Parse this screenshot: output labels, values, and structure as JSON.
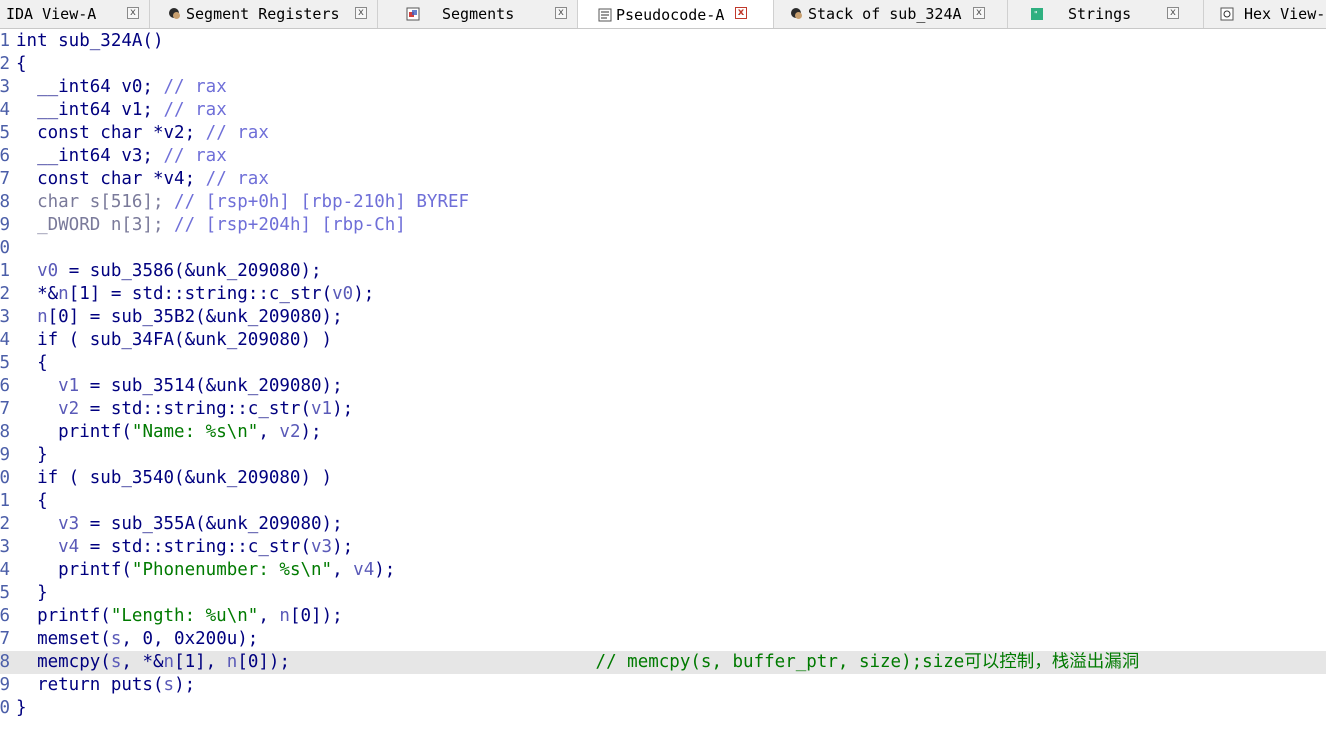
{
  "tabs": [
    {
      "label": "IDA View-A",
      "icon": "ida-view-icon",
      "active": false
    },
    {
      "label": "Segment Registers",
      "icon": "segment-registers-icon",
      "active": false
    },
    {
      "label": "Segments",
      "icon": "segments-icon",
      "active": false
    },
    {
      "label": "Pseudocode-A",
      "icon": "pseudocode-icon",
      "active": true
    },
    {
      "label": "Stack of sub_324A",
      "icon": "stack-icon",
      "active": false
    },
    {
      "label": "Strings",
      "icon": "strings-icon",
      "active": false
    },
    {
      "label": "Hex View-",
      "icon": "hex-view-icon",
      "active": false
    }
  ],
  "close_glyph": "x",
  "colors": {
    "keyword": "#00007f",
    "comment": "#6f6fd8",
    "variable": "#5a5ab8",
    "string": "#007a00",
    "highlight_line": "#e6e6e6",
    "active_close": "#c0392b"
  },
  "code": {
    "highlight_line": 28,
    "lines": [
      {
        "n": "1",
        "segs": [
          {
            "c": "t-plain",
            "t": "int sub_324A()"
          }
        ]
      },
      {
        "n": "2",
        "segs": [
          {
            "c": "t-plain",
            "t": "{"
          }
        ]
      },
      {
        "n": "3",
        "segs": [
          {
            "c": "t-plain",
            "t": "  __int64 v0; "
          },
          {
            "c": "t-comment",
            "t": "// rax"
          }
        ]
      },
      {
        "n": "4",
        "segs": [
          {
            "c": "t-plain",
            "t": "  __int64 v1; "
          },
          {
            "c": "t-comment",
            "t": "// rax"
          }
        ]
      },
      {
        "n": "5",
        "segs": [
          {
            "c": "t-plain",
            "t": "  const char *v2; "
          },
          {
            "c": "t-comment",
            "t": "// rax"
          }
        ]
      },
      {
        "n": "6",
        "segs": [
          {
            "c": "t-plain",
            "t": "  __int64 v3; "
          },
          {
            "c": "t-comment",
            "t": "// rax"
          }
        ]
      },
      {
        "n": "7",
        "segs": [
          {
            "c": "t-plain",
            "t": "  const char *v4; "
          },
          {
            "c": "t-comment",
            "t": "// rax"
          }
        ]
      },
      {
        "n": "8",
        "segs": [
          {
            "c": "t-gray",
            "t": "  char s[516]; "
          },
          {
            "c": "t-comment",
            "t": "// [rsp+0h] [rbp-210h] BYREF"
          }
        ]
      },
      {
        "n": "9",
        "segs": [
          {
            "c": "t-gray",
            "t": "  _DWORD n[3]; "
          },
          {
            "c": "t-comment",
            "t": "// [rsp+204h] [rbp-Ch]"
          }
        ]
      },
      {
        "n": "0",
        "segs": [
          {
            "c": "t-plain",
            "t": ""
          }
        ]
      },
      {
        "n": "1",
        "segs": [
          {
            "c": "t-var",
            "t": "  v0"
          },
          {
            "c": "t-plain",
            "t": " = sub_3586(&unk_209080);"
          }
        ]
      },
      {
        "n": "2",
        "segs": [
          {
            "c": "t-plain",
            "t": "  *&"
          },
          {
            "c": "t-var",
            "t": "n"
          },
          {
            "c": "t-plain",
            "t": "[1] = std::string::c_str("
          },
          {
            "c": "t-var",
            "t": "v0"
          },
          {
            "c": "t-plain",
            "t": ");"
          }
        ]
      },
      {
        "n": "3",
        "segs": [
          {
            "c": "t-var",
            "t": "  n"
          },
          {
            "c": "t-plain",
            "t": "[0] = sub_35B2(&unk_209080);"
          }
        ]
      },
      {
        "n": "4",
        "segs": [
          {
            "c": "t-plain",
            "t": "  if ( sub_34FA(&unk_209080) )"
          }
        ]
      },
      {
        "n": "5",
        "segs": [
          {
            "c": "t-plain",
            "t": "  {"
          }
        ]
      },
      {
        "n": "6",
        "segs": [
          {
            "c": "t-var",
            "t": "    v1"
          },
          {
            "c": "t-plain",
            "t": " = sub_3514(&unk_209080);"
          }
        ]
      },
      {
        "n": "7",
        "segs": [
          {
            "c": "t-var",
            "t": "    v2"
          },
          {
            "c": "t-plain",
            "t": " = std::string::c_str("
          },
          {
            "c": "t-var",
            "t": "v1"
          },
          {
            "c": "t-plain",
            "t": ");"
          }
        ]
      },
      {
        "n": "8",
        "segs": [
          {
            "c": "t-plain",
            "t": "    printf("
          },
          {
            "c": "t-str",
            "t": "\"Name: %s\\n\""
          },
          {
            "c": "t-plain",
            "t": ", "
          },
          {
            "c": "t-var",
            "t": "v2"
          },
          {
            "c": "t-plain",
            "t": ");"
          }
        ]
      },
      {
        "n": "9",
        "segs": [
          {
            "c": "t-plain",
            "t": "  }"
          }
        ]
      },
      {
        "n": "0",
        "segs": [
          {
            "c": "t-plain",
            "t": "  if ( sub_3540(&unk_209080) )"
          }
        ]
      },
      {
        "n": "1",
        "segs": [
          {
            "c": "t-plain",
            "t": "  {"
          }
        ]
      },
      {
        "n": "2",
        "segs": [
          {
            "c": "t-var",
            "t": "    v3"
          },
          {
            "c": "t-plain",
            "t": " = sub_355A(&unk_209080);"
          }
        ]
      },
      {
        "n": "3",
        "segs": [
          {
            "c": "t-var",
            "t": "    v4"
          },
          {
            "c": "t-plain",
            "t": " = std::string::c_str("
          },
          {
            "c": "t-var",
            "t": "v3"
          },
          {
            "c": "t-plain",
            "t": ");"
          }
        ]
      },
      {
        "n": "4",
        "segs": [
          {
            "c": "t-plain",
            "t": "    printf("
          },
          {
            "c": "t-str",
            "t": "\"Phonenumber: %s\\n\""
          },
          {
            "c": "t-plain",
            "t": ", "
          },
          {
            "c": "t-var",
            "t": "v4"
          },
          {
            "c": "t-plain",
            "t": ");"
          }
        ]
      },
      {
        "n": "5",
        "segs": [
          {
            "c": "t-plain",
            "t": "  }"
          }
        ]
      },
      {
        "n": "6",
        "segs": [
          {
            "c": "t-plain",
            "t": "  printf("
          },
          {
            "c": "t-str",
            "t": "\"Length: %u\\n\""
          },
          {
            "c": "t-plain",
            "t": ", "
          },
          {
            "c": "t-var",
            "t": "n"
          },
          {
            "c": "t-plain",
            "t": "[0]);"
          }
        ]
      },
      {
        "n": "7",
        "segs": [
          {
            "c": "t-plain",
            "t": "  memset("
          },
          {
            "c": "t-var",
            "t": "s"
          },
          {
            "c": "t-plain",
            "t": ", 0, 0x200u);"
          }
        ]
      },
      {
        "n": "8",
        "segs": [
          {
            "c": "t-plain",
            "t": "  memcpy("
          },
          {
            "c": "t-var",
            "t": "s"
          },
          {
            "c": "t-plain",
            "t": ", *&"
          },
          {
            "c": "t-var",
            "t": "n"
          },
          {
            "c": "t-plain",
            "t": "[1], "
          },
          {
            "c": "t-var",
            "t": "n"
          },
          {
            "c": "t-plain",
            "t": "[0]);                             "
          },
          {
            "c": "t-cm2",
            "t": "// memcpy(s, buffer_ptr, size);size可以控制，栈溢出漏洞"
          }
        ]
      },
      {
        "n": "9",
        "segs": [
          {
            "c": "t-plain",
            "t": "  return puts("
          },
          {
            "c": "t-var",
            "t": "s"
          },
          {
            "c": "t-plain",
            "t": ");"
          }
        ]
      },
      {
        "n": "0",
        "segs": [
          {
            "c": "t-plain",
            "t": "}"
          }
        ]
      }
    ]
  }
}
